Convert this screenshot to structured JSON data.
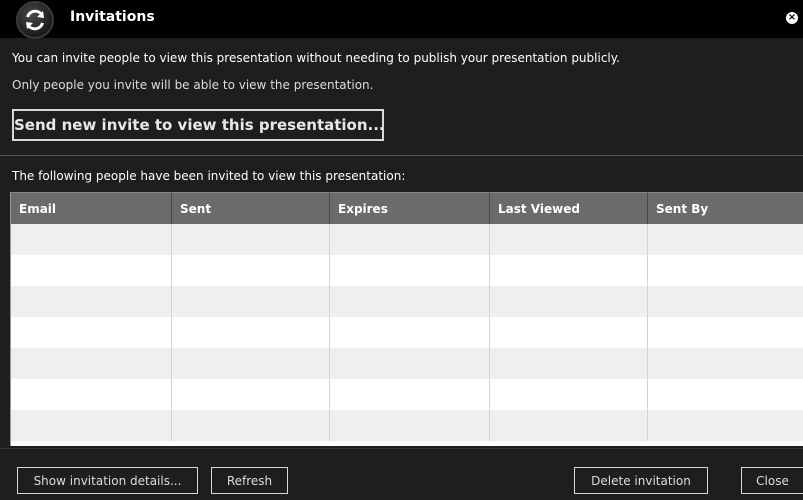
{
  "dialog": {
    "title": "Invitations",
    "close_glyph": "×",
    "app_icon": "refresh-icon"
  },
  "info": {
    "line1": "You can invite people to view this presentation without needing to publish your presentation publicly.",
    "line2": "Only people you invite will be able to view the presentation."
  },
  "send_button_label": "Send new invite to view this presentation...",
  "list_caption": "The following people have been invited to view this presentation:",
  "table": {
    "columns": [
      "Email",
      "Sent",
      "Expires",
      "Last Viewed",
      "Sent By"
    ],
    "rows": [
      [
        "",
        "",
        "",
        "",
        ""
      ],
      [
        "",
        "",
        "",
        "",
        ""
      ],
      [
        "",
        "",
        "",
        "",
        ""
      ],
      [
        "",
        "",
        "",
        "",
        ""
      ],
      [
        "",
        "",
        "",
        "",
        ""
      ],
      [
        "",
        "",
        "",
        "",
        ""
      ],
      [
        "",
        "",
        "",
        "",
        ""
      ]
    ]
  },
  "footer": {
    "details_label": "Show invitation details...",
    "refresh_label": "Refresh",
    "delete_label": "Delete invitation",
    "close_label": "Close"
  },
  "colors": {
    "background": "#1e1e1e",
    "titlebar": "#000000",
    "header": "#6b6b6b",
    "row_alt": "#efefef"
  }
}
